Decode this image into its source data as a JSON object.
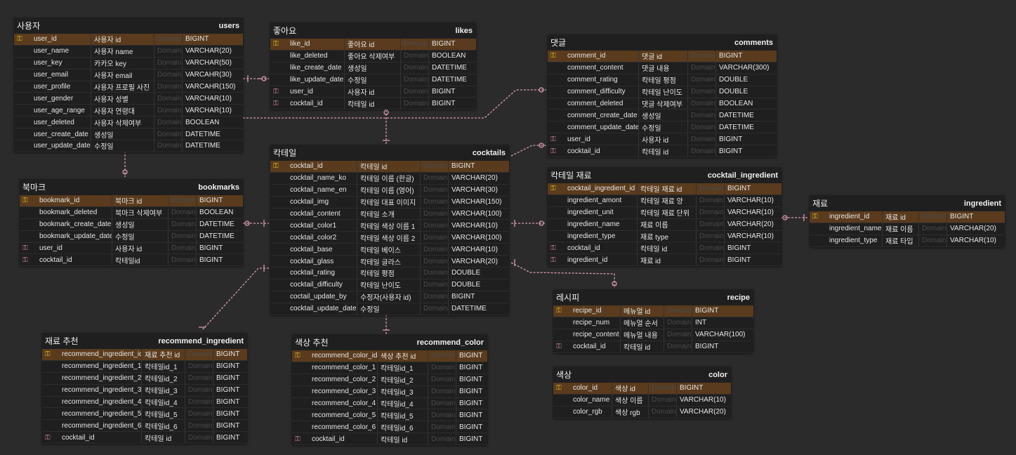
{
  "tables": [
    {
      "id": "users",
      "title": "사용자",
      "entity": "users",
      "rows": [
        {
          "key": "pk",
          "name": "user_id",
          "logical": "사용자 id",
          "domain": "Domain",
          "type": "BIGINT"
        },
        {
          "key": "",
          "name": "user_name",
          "logical": "사용자 name",
          "domain": "Domain",
          "type": "VARCHAR(20)"
        },
        {
          "key": "",
          "name": "user_key",
          "logical": "카카오 key",
          "domain": "Domain",
          "type": "VARCHAR(50)"
        },
        {
          "key": "",
          "name": "user_email",
          "logical": "사용자 email",
          "domain": "Domain",
          "type": "VARCAHR(30)"
        },
        {
          "key": "",
          "name": "user_profile",
          "logical": "사용자 프로필 사진",
          "domain": "Domain",
          "type": "VARCAHR(150)"
        },
        {
          "key": "",
          "name": "user_gender",
          "logical": "사용자 성별",
          "domain": "Domain",
          "type": "VARCHAR(10)"
        },
        {
          "key": "",
          "name": "user_age_range",
          "logical": "사용자 연령대",
          "domain": "Domain",
          "type": "VARCHAR(10)"
        },
        {
          "key": "",
          "name": "user_deleted",
          "logical": "사용자 삭제여부",
          "domain": "Domain",
          "type": "BOOLEAN"
        },
        {
          "key": "",
          "name": "user_create_date",
          "logical": "생성일",
          "domain": "Domain",
          "type": "DATETIME"
        },
        {
          "key": "",
          "name": "user_update_date",
          "logical": "수정일",
          "domain": "Domain",
          "type": "DATETIME"
        }
      ]
    },
    {
      "id": "likes",
      "title": "좋아요",
      "entity": "likes",
      "rows": [
        {
          "key": "pk",
          "name": "like_id",
          "logical": "좋아요 id",
          "domain": "Domain",
          "type": "BIGINT"
        },
        {
          "key": "",
          "name": "like_deleted",
          "logical": "좋아요 삭제여부",
          "domain": "Domain",
          "type": "BOOLEAN"
        },
        {
          "key": "",
          "name": "like_create_date",
          "logical": "생성일",
          "domain": "Domain",
          "type": "DATETIME"
        },
        {
          "key": "",
          "name": "like_update_date",
          "logical": "수정일",
          "domain": "Domain",
          "type": "DATETIME"
        },
        {
          "key": "fk",
          "name": "user_id",
          "logical": "사용자 id",
          "domain": "Domain",
          "type": "BIGINT"
        },
        {
          "key": "fk",
          "name": "cocktail_id",
          "logical": "칵테일 id",
          "domain": "Domain",
          "type": "BIGINT"
        }
      ]
    },
    {
      "id": "comments",
      "title": "댓글",
      "entity": "comments",
      "rows": [
        {
          "key": "pk",
          "name": "comment_id",
          "logical": "댓글 id",
          "domain": "Domain",
          "type": "BIGINT"
        },
        {
          "key": "",
          "name": "comment_content",
          "logical": "댓글 내용",
          "domain": "Domain",
          "type": "VARCHAR(300)"
        },
        {
          "key": "",
          "name": "comment_rating",
          "logical": "칵테일 평점",
          "domain": "Domain",
          "type": "DOUBLE"
        },
        {
          "key": "",
          "name": "comment_difficulty",
          "logical": "칵테일 난이도",
          "domain": "Domain",
          "type": "DOUBLE"
        },
        {
          "key": "",
          "name": "comment_deleted",
          "logical": "댓글 삭제여부",
          "domain": "Domain",
          "type": "BOOLEAN"
        },
        {
          "key": "",
          "name": "comment_create_date",
          "logical": "생성일",
          "domain": "Domain",
          "type": "DATETIME"
        },
        {
          "key": "",
          "name": "comment_update_date",
          "logical": "수정일",
          "domain": "Domain",
          "type": "DATETIME"
        },
        {
          "key": "fk",
          "name": "user_id",
          "logical": "사용자 id",
          "domain": "Domain",
          "type": "BIGINT"
        },
        {
          "key": "fk",
          "name": "cocktail_id",
          "logical": "칵테일 id",
          "domain": "Domain",
          "type": "BIGINT"
        }
      ]
    },
    {
      "id": "bookmarks",
      "title": "북마크",
      "entity": "bookmarks",
      "rows": [
        {
          "key": "pk",
          "name": "bookmark_id",
          "logical": "북마크 id",
          "domain": "Domain",
          "type": "BIGINT"
        },
        {
          "key": "",
          "name": "bookmark_deleted",
          "logical": "북마크 삭제여부",
          "domain": "Domain",
          "type": "BOOLEAN"
        },
        {
          "key": "",
          "name": "bookmark_create_date",
          "logical": "생성일",
          "domain": "Domain",
          "type": "DATETIME"
        },
        {
          "key": "",
          "name": "bookmark_update_date",
          "logical": "수정일",
          "domain": "Domain",
          "type": "DATETIME"
        },
        {
          "key": "fk",
          "name": "user_id",
          "logical": "사용자 id",
          "domain": "Domain",
          "type": "BIGINT"
        },
        {
          "key": "fk",
          "name": "cocktail_id",
          "logical": "칵테일id",
          "domain": "Domain",
          "type": "BIGINT"
        }
      ]
    },
    {
      "id": "cocktails",
      "title": "칵테일",
      "entity": "cocktails",
      "rows": [
        {
          "key": "pk",
          "name": "cocktail_id",
          "logical": "칵테일 id",
          "domain": "Domain",
          "type": "BIGINT"
        },
        {
          "key": "",
          "name": "cocktail_name_ko",
          "logical": "칵테일 이름 (한글)",
          "domain": "Domain",
          "type": "VARCHAR(20)"
        },
        {
          "key": "",
          "name": "cocktail_name_en",
          "logical": "칵테일 이름 (영어)",
          "domain": "Domain",
          "type": "VARCHAR(30)"
        },
        {
          "key": "",
          "name": "cocktail_img",
          "logical": "칵테일 대표 이미지",
          "domain": "Domain",
          "type": "VARCHAR(150)"
        },
        {
          "key": "",
          "name": "cocktail_content",
          "logical": "칵테일 소개",
          "domain": "Domain",
          "type": "VARCHAR(100)"
        },
        {
          "key": "",
          "name": "cocktail_color1",
          "logical": "칵테일 색상 이름 1",
          "domain": "Domain",
          "type": "VARCHAR(10)"
        },
        {
          "key": "",
          "name": "cocktail_color2",
          "logical": "칵테일 색상 이름 2",
          "domain": "Domain",
          "type": "VARCHAR(100)"
        },
        {
          "key": "",
          "name": "cocktail_base",
          "logical": "칵테일 베이스",
          "domain": "Domain",
          "type": "VARCHAR(10)"
        },
        {
          "key": "",
          "name": "cocktail_glass",
          "logical": "칵테일 글라스",
          "domain": "Domain",
          "type": "VARCHAR(20)"
        },
        {
          "key": "",
          "name": "cocktail_rating",
          "logical": "칵테일 평점",
          "domain": "Domain",
          "type": "DOUBLE"
        },
        {
          "key": "",
          "name": "cocktail_difficulty",
          "logical": "칵테일 난이도",
          "domain": "Domain",
          "type": "DOUBLE"
        },
        {
          "key": "",
          "name": "coctail_update_by",
          "logical": "수정자(사용자 id)",
          "domain": "Domain",
          "type": "BIGINT"
        },
        {
          "key": "",
          "name": "cocktail_update_date",
          "logical": "수정일",
          "domain": "Domain",
          "type": "DATETIME"
        }
      ]
    },
    {
      "id": "cocktail_ingredient",
      "title": "칵테일 재료",
      "entity": "cocktail_ingredient",
      "rows": [
        {
          "key": "pk",
          "name": "cocktail_ingredient_id",
          "logical": "칵테일 재료 id",
          "domain": "Domain",
          "type": "BIGINT"
        },
        {
          "key": "",
          "name": "ingredient_amont",
          "logical": "칵테일 재료 양",
          "domain": "Domain",
          "type": "VARCHAR(10)"
        },
        {
          "key": "",
          "name": "ingredient_unit",
          "logical": "칵테일 재료 단위",
          "domain": "Domain",
          "type": "VARCHAR(10)"
        },
        {
          "key": "",
          "name": "ingredient_name",
          "logical": "재료 이름",
          "domain": "Domain",
          "type": "VARCHAR(20)"
        },
        {
          "key": "",
          "name": "ingredient_type",
          "logical": "재료 type",
          "domain": "Domain",
          "type": "VARCHAR(10)"
        },
        {
          "key": "fk",
          "name": "cocktail_id",
          "logical": "칵테일 id",
          "domain": "Domain",
          "type": "BIGINT"
        },
        {
          "key": "fk",
          "name": "ingredient_id",
          "logical": "재료 id",
          "domain": "Domain",
          "type": "BIGINT"
        }
      ]
    },
    {
      "id": "ingredient",
      "title": "재료",
      "entity": "ingredient",
      "rows": [
        {
          "key": "pk",
          "name": "ingredient_id",
          "logical": "재료 id",
          "domain": "Domain",
          "type": "BIGINT"
        },
        {
          "key": "",
          "name": "ingredient_name",
          "logical": "재료 이름",
          "domain": "Domain",
          "type": "VARCHAR(20)"
        },
        {
          "key": "",
          "name": "ingredient_type",
          "logical": "재료 타입",
          "domain": "Domain",
          "type": "VARCHAR(10)"
        }
      ]
    },
    {
      "id": "recipe",
      "title": "레시피",
      "entity": "recipe",
      "rows": [
        {
          "key": "pk",
          "name": "recipe_id",
          "logical": "메뉴얼 id",
          "domain": "Domain",
          "type": "BIGINT"
        },
        {
          "key": "",
          "name": "recipe_num",
          "logical": "메뉴얼 순서",
          "domain": "Domain",
          "type": "INT"
        },
        {
          "key": "",
          "name": "recipe_content",
          "logical": "메뉴얼 내용",
          "domain": "Domain",
          "type": "VARCHAR(100)"
        },
        {
          "key": "fk",
          "name": "cocktail_id",
          "logical": "칵테일 id",
          "domain": "Domain",
          "type": "BIGINT"
        }
      ]
    },
    {
      "id": "color",
      "title": "색상",
      "entity": "color",
      "rows": [
        {
          "key": "pk",
          "name": "color_id",
          "logical": "색상 id",
          "domain": "Domain",
          "type": "BIGINT"
        },
        {
          "key": "",
          "name": "color_name",
          "logical": "색상 이름",
          "domain": "Domain",
          "type": "VARCHAR(10)"
        },
        {
          "key": "",
          "name": "color_rgb",
          "logical": "색상 rgb",
          "domain": "Domain",
          "type": "VARCHAR(20)"
        }
      ]
    },
    {
      "id": "recommend_ingredient",
      "title": "재료 추천",
      "entity": "recommend_ingredient",
      "rows": [
        {
          "key": "pk",
          "name": "recommend_ingredient_id",
          "logical": "재료 추천 id",
          "domain": "Domain",
          "type": "BIGINT"
        },
        {
          "key": "",
          "name": "recommend_ingredient_1",
          "logical": "칵테일id_1",
          "domain": "Domain",
          "type": "BIGINT"
        },
        {
          "key": "",
          "name": "recommend_ingredient_2",
          "logical": "칵테일id_2",
          "domain": "Domain",
          "type": "BIGINT"
        },
        {
          "key": "",
          "name": "recommend_ingredient_3",
          "logical": "칵테일id_3",
          "domain": "Domain",
          "type": "BIGINT"
        },
        {
          "key": "",
          "name": "recommend_ingredient_4",
          "logical": "칵테일id_4",
          "domain": "Domain",
          "type": "BIGINT"
        },
        {
          "key": "",
          "name": "recommend_ingredient_5",
          "logical": "칵테일id_5",
          "domain": "Domain",
          "type": "BIGINT"
        },
        {
          "key": "",
          "name": "recommend_ingredient_6",
          "logical": "칵테일id_6",
          "domain": "Domain",
          "type": "BIGINT"
        },
        {
          "key": "fk",
          "name": "cocktail_id",
          "logical": "칵테일 id",
          "domain": "Domain",
          "type": "BIGINT"
        }
      ]
    },
    {
      "id": "recommend_color",
      "title": "색상 추천",
      "entity": "recommend_color",
      "rows": [
        {
          "key": "pk",
          "name": "recommend_color_id",
          "logical": "색상 추천 id",
          "domain": "Domain",
          "type": "BIGINT"
        },
        {
          "key": "",
          "name": "recommend_color_1",
          "logical": "칵테일id_1",
          "domain": "Domain",
          "type": "BIGINT"
        },
        {
          "key": "",
          "name": "recommend_color_2",
          "logical": "칵테일id_2",
          "domain": "Domain",
          "type": "BIGINT"
        },
        {
          "key": "",
          "name": "recommend_color_3",
          "logical": "칵테일id_3",
          "domain": "Domain",
          "type": "BIGINT"
        },
        {
          "key": "",
          "name": "recommend_color_4",
          "logical": "칵테일id_4",
          "domain": "Domain",
          "type": "BIGINT"
        },
        {
          "key": "",
          "name": "recommend_color_5",
          "logical": "칵테일id_5",
          "domain": "Domain",
          "type": "BIGINT"
        },
        {
          "key": "",
          "name": "recommend_color_6",
          "logical": "칵테일id_6",
          "domain": "Domain",
          "type": "BIGINT"
        },
        {
          "key": "fk",
          "name": "cocktail_id",
          "logical": "칵테일 id",
          "domain": "Domain",
          "type": "BIGINT"
        }
      ]
    }
  ],
  "colors": {
    "canvas": "#2b2b2b",
    "table_body": "#1f1f1f",
    "pk_row": "#5a3b1d",
    "relation_line": "#d79aa8",
    "pk_icon": "#e0c020",
    "fk_icon": "#d08aa0"
  },
  "icons": {
    "primary_key": "key-icon",
    "foreign_key": "foreign-key-icon"
  }
}
